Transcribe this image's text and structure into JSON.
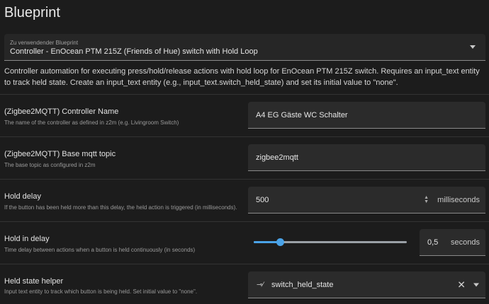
{
  "page_title": "Blueprint",
  "blueprint_select": {
    "label": "Zu verwendender Blueprint",
    "value": "Controller - EnOcean PTM 215Z (Friends of Hue) switch with Hold Loop"
  },
  "description": "Controller automation for executing press/hold/release actions with hold loop for EnOcean PTM 215Z switch. Requires an input_text entity to track held state. Create an input_text entity (e.g., input_text.switch_held_state) and set its initial value to \"none\".",
  "fields": {
    "controller_name": {
      "title": "(Zigbee2MQTT) Controller Name",
      "help": "The name of the controller as defined in z2m (e.g. Livingroom Switch)",
      "value": "A4 EG Gäste WC Schalter"
    },
    "base_topic": {
      "title": "(Zigbee2MQTT) Base mqtt topic",
      "help": "The base topic as configured in z2m",
      "value": "zigbee2mqtt"
    },
    "hold_delay": {
      "title": "Hold delay",
      "help": "If the button has been held more than this delay, the held action is triggered (in milliseconds).",
      "value": "500",
      "unit": "milliseconds"
    },
    "hold_in_delay": {
      "title": "Hold in delay",
      "help": "Time delay between actions when a button is held continuously (in seconds)",
      "value": "0,5",
      "unit": "seconds",
      "slider_fraction": 0.17
    },
    "held_state_helper": {
      "title": "Held state helper",
      "help": "Input text entity to track which button is being held. Set initial value to \"none\".",
      "value": "switch_held_state"
    }
  },
  "icons": {
    "dropdown": "chevron-down-icon",
    "spinner": "up-down-spinner-icon",
    "entity": "input-text-icon",
    "clear": "close-icon"
  },
  "colors": {
    "accent": "#4aa3e8",
    "background": "#1c1c1c"
  }
}
